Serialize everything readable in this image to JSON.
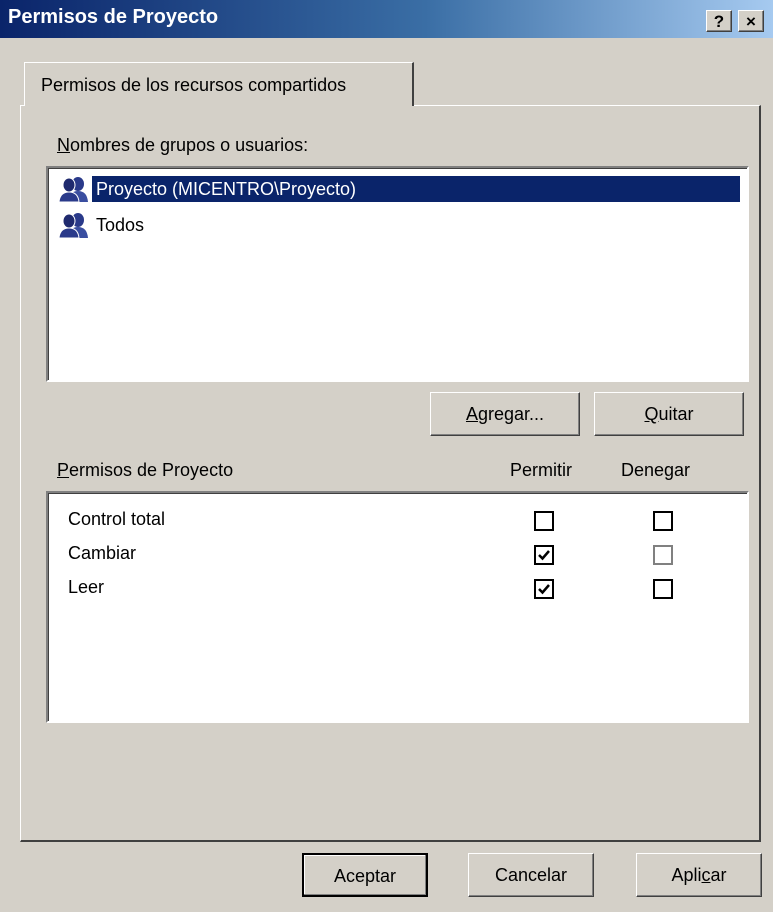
{
  "window": {
    "title": "Permisos de Proyecto",
    "help_button": "?",
    "close_button": "×"
  },
  "tabs": [
    {
      "label": "Permisos de los recursos compartidos",
      "active": true
    }
  ],
  "groups": {
    "label_first": "N",
    "label_rest": "ombres de grupos o usuarios:",
    "items": [
      {
        "name": "Proyecto (MICENTRO\\Proyecto)",
        "selected": true,
        "icon": "users-group-icon"
      },
      {
        "name": "Todos",
        "selected": false,
        "icon": "users-group-icon"
      }
    ]
  },
  "group_buttons": {
    "add_first": "A",
    "add_rest": "gregar...",
    "remove_first": "Q",
    "remove_rest": "uitar"
  },
  "permissions": {
    "header_first": "P",
    "header_rest": "ermisos de Proyecto",
    "allow_header": "Permitir",
    "deny_header": "Denegar",
    "rows": [
      {
        "name": "Control total",
        "allow": false,
        "deny": false
      },
      {
        "name": "Cambiar",
        "allow": true,
        "deny": false
      },
      {
        "name": "Leer",
        "allow": true,
        "deny": false
      }
    ]
  },
  "dialog_buttons": {
    "ok": "Aceptar",
    "cancel": "Cancelar",
    "apply_before": "Apli",
    "apply_underlined": "c",
    "apply_after": "ar"
  },
  "colors": {
    "face": "#d4d0c8",
    "selection": "#0a246a",
    "title_start": "#0a246a",
    "title_end": "#a6caf0"
  }
}
